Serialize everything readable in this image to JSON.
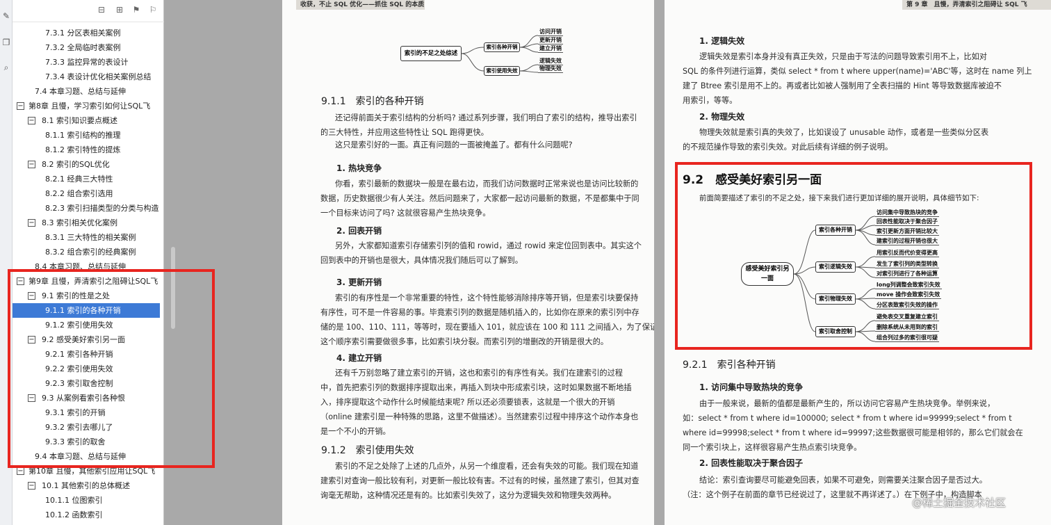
{
  "toolstrip": {
    "icons": [
      "edit-icon",
      "copy-icon",
      "search-icon"
    ]
  },
  "toolbar": {
    "icons": [
      "collapse-all-icon",
      "expand-all-icon",
      "bookmark-add-icon",
      "bookmark-icon"
    ]
  },
  "outline": [
    {
      "label": "7.3.1 分区表相关案例",
      "level": 3
    },
    {
      "label": "7.3.2 全局临时表案例",
      "level": 3
    },
    {
      "label": "7.3.3 监控异常的表设计",
      "level": 3
    },
    {
      "label": "7.3.4 表设计优化相关案例总结",
      "level": 3
    },
    {
      "label": "7.4 本章习题、总结与延伸",
      "level": 2
    },
    {
      "label": "第8章 且慢，学习索引如何让SQL飞",
      "level": 1,
      "expander": "−"
    },
    {
      "label": "8.1 索引知识要点概述",
      "level": 2,
      "expander": "−"
    },
    {
      "label": "8.1.1 索引结构的推理",
      "level": 3
    },
    {
      "label": "8.1.2 索引特性的提炼",
      "level": 3
    },
    {
      "label": "8.2 索引的SQL优化",
      "level": 2,
      "expander": "−"
    },
    {
      "label": "8.2.1 经典三大特性",
      "level": 3
    },
    {
      "label": "8.2.2 组合索引选用",
      "level": 3
    },
    {
      "label": "8.2.3 索引扫描类型的分类与构造",
      "level": 3
    },
    {
      "label": "8.3 索引相关优化案例",
      "level": 2,
      "expander": "−"
    },
    {
      "label": "8.3.1 三大特性的相关案例",
      "level": 3
    },
    {
      "label": "8.3.2 组合索引的经典案例",
      "level": 3
    },
    {
      "label": "8.4 本章习题、总结与延伸",
      "level": 2
    },
    {
      "label": "第9章 且慢，弄清索引之阻碍让SQL飞",
      "level": 1,
      "expander": "−"
    },
    {
      "label": "9.1 索引的性是之处",
      "level": 2,
      "expander": "−"
    },
    {
      "label": "9.1.1 索引的各种开销",
      "level": 3,
      "selected": true
    },
    {
      "label": "9.1.2 索引使用失效",
      "level": 3
    },
    {
      "label": "9.2 感受美好索引另一面",
      "level": 2,
      "expander": "−"
    },
    {
      "label": "9.2.1 索引各种开销",
      "level": 3
    },
    {
      "label": "9.2.2 索引使用失效",
      "level": 3
    },
    {
      "label": "9.2.3 索引取舍控制",
      "level": 3
    },
    {
      "label": "9.3 从案例看索引各种恨",
      "level": 2,
      "expander": "−"
    },
    {
      "label": "9.3.1 索引的开销",
      "level": 3
    },
    {
      "label": "9.3.2 索引去哪儿了",
      "level": 3
    },
    {
      "label": "9.3.3 索引的取舍",
      "level": 3
    },
    {
      "label": "9.4 本章习题、总结与延伸",
      "level": 2
    },
    {
      "label": "第10章 且慢，其他索引应用让SQL飞",
      "level": 1,
      "expander": "−"
    },
    {
      "label": "10.1 其他索引的总体概述",
      "level": 2,
      "expander": "−"
    },
    {
      "label": "10.1.1 位图索引",
      "level": 3
    },
    {
      "label": "10.1.2 函数索引",
      "level": 3
    }
  ],
  "left_page": {
    "running_header": "收获，不止 SQL 优化——抓住 SQL 的本质",
    "mindmap": {
      "root": "索引的不足之处综述",
      "branches": [
        {
          "label": "索引各种开销",
          "leaves": [
            "访问开销",
            "更新开销",
            "建立开销"
          ]
        },
        {
          "label": "索引使用失效",
          "leaves": [
            "逻辑失效",
            "物理失效"
          ]
        }
      ]
    },
    "s911_title": "9.1.1　索引的各种开销",
    "s911_p1": [
      "还记得前面关于索引结构的分析吗? 通过系列步骤，我们明白了索引的结构，推导出索引",
      "的三大特性，并应用这些特性让 SQL 跑得更快。"
    ],
    "s911_p2": "这只是索引好的一面。真正有问题的一面被掩盖了。都有什么问题呢?",
    "h1": "1. 热块竞争",
    "p_h1": [
      "你看，索引最新的数据块一般是在最右边，而我们访问数据时正常来说也是访问比较新的",
      "数据，历史数据很少有人关注。然后问题来了，大家都一起访问最新的数据，不是都集中于同",
      "一个目标来访问了吗? 这就很容易产生热块竞争。"
    ],
    "h2": "2. 回表开销",
    "p_h2": [
      "另外，大家都知道索引存储索引列的值和 rowid，通过 rowid 来定位回到表中。其实这个",
      "回到表中的开销也是很大，具体情况我们随后可以了解到。"
    ],
    "h3": "3. 更新开销",
    "p_h3": [
      "索引的有序性是一个非常重要的特性，这个特性能够消除排序等开销，但是索引块要保持",
      "有序性，可不是一件容易的事。毕竟索引列的数据是随机插入的，比如你在原来的索引列中存",
      "储的是 100、110、111，等等时，现在要插入 101，就应该在 100 和 111 之间插入，为了保证",
      "这个顺序索引需要做很多事，比如索引块分裂。而索引列的增删改的开销是很大的。"
    ],
    "h4": "4. 建立开销",
    "p_h4": [
      "还有千万别忽略了建立索引的开销，这也和索引的有序性有关。我们在建索引的过程",
      "中，首先把索引列的数据排序提取出来，再插入到块中形成索引块，这时如果数据不断地插",
      "入，排序提取这个动作什么时候能结束呢? 所以还必须要锁表，这就是一个很大的开销",
      "（online 建索引是一种特殊的思路，这里不做描述）。当然建索引过程中排序这个动作本身也",
      "是一个不小的开销。"
    ],
    "s912_title": "9.1.2　索引使用失效",
    "s912_p": [
      "索引的不足之处除了上述的几点外，从另一个维度看，还会有失效的可能。我们现在知道",
      "建索引对查询一般比较有利，对更新一般比较有害。不过有的时候，虽然建了索引，但其对查",
      "询毫无帮助，这种情况还是有的。比如索引失效了，这分为逻辑失效和物理失效两种。"
    ]
  },
  "right_page": {
    "running_header": "第 9 章　且慢，弄清索引之阻碍让 SQL 飞",
    "h_logic": "1. 逻辑失效",
    "p_logic": [
      "逻辑失效是索引本身并没有真正失效，只是由于写法的问题导致索引用不上，比如对",
      "SQL 的条件列进行运算，类似 select * from t where upper(name)='ABC'等，这时在 name 列上",
      "建了 Btree 索引是用不上的。再或者比如被人强制用了全表扫描的 Hint 等导致数据库被迫不",
      "用索引，等等。"
    ],
    "h_phys": "2. 物理失效",
    "p_phys": [
      "物理失效就是索引真的失效了，比如误设了 unusable 动作，或者是一些类似分区表",
      "的不规范操作导致的索引失效。对此后续有详细的例子说明。"
    ],
    "s92_title": "9.2　感受美好索引另一面",
    "s92_intro": "前面简要描述了索引的不足之处，接下来我们进行更加详细的展开说明，具体细节如下:",
    "mindmap2": {
      "root": "感受美好索引另一面",
      "branches": [
        {
          "label": "索引各种开销",
          "leaves": [
            "访问集中导致热块的竞争",
            "回表性能取决于聚合因子",
            "索引更新方面开销比较大",
            "建索引的过程开销也很大"
          ]
        },
        {
          "label": "索引逻辑失效",
          "leaves": [
            "用索引反而代价变得更高",
            "发生了索引列的类型转换",
            "对索引列进行了各种运算"
          ]
        },
        {
          "label": "索引物理失效",
          "leaves": [
            "long列调整会致索引失效",
            "move 操作会致索引失效",
            "分区表致索引失效的操作"
          ]
        },
        {
          "label": "索引取舍控制",
          "leaves": [
            "避免表交叉重复建立索引",
            "删除系统从未用到的索引",
            "组合列过多的索引很可疑"
          ]
        }
      ]
    },
    "s921_title": "9.2.1　索引各种开销",
    "h_access": "1. 访问集中导致热块的竞争",
    "p_access": [
      "由于一般来说，最新的值都是最新产生的，所以访问它容易产生热块竞争。举例来说，",
      "如：select * from t where id=100000; select * from t where id=99999;select * from t",
      "where id=99998;select * from t where id=99997;这些数据很可能是相邻的，那么它们就会在",
      "同一个索引块上，这样很容易产生热点索引块竞争。"
    ],
    "h_cluster": "2. 回表性能取决于聚合因子",
    "p_cluster": [
      "结论：索引查询要尽可能避免回表，如果不可避免，则需要关注聚合因子是否过大。",
      "（注：这个例子在前面的章节已经说过了，这里就不再详述了。）在下例子中，构造脚本"
    ]
  },
  "watermark": "@稀土掘金技术社区",
  "colors": {
    "selection": "#3d7ad6",
    "highlight_box": "#e8251f",
    "page": "#fbfbfa",
    "background": "#a9a9a9"
  }
}
